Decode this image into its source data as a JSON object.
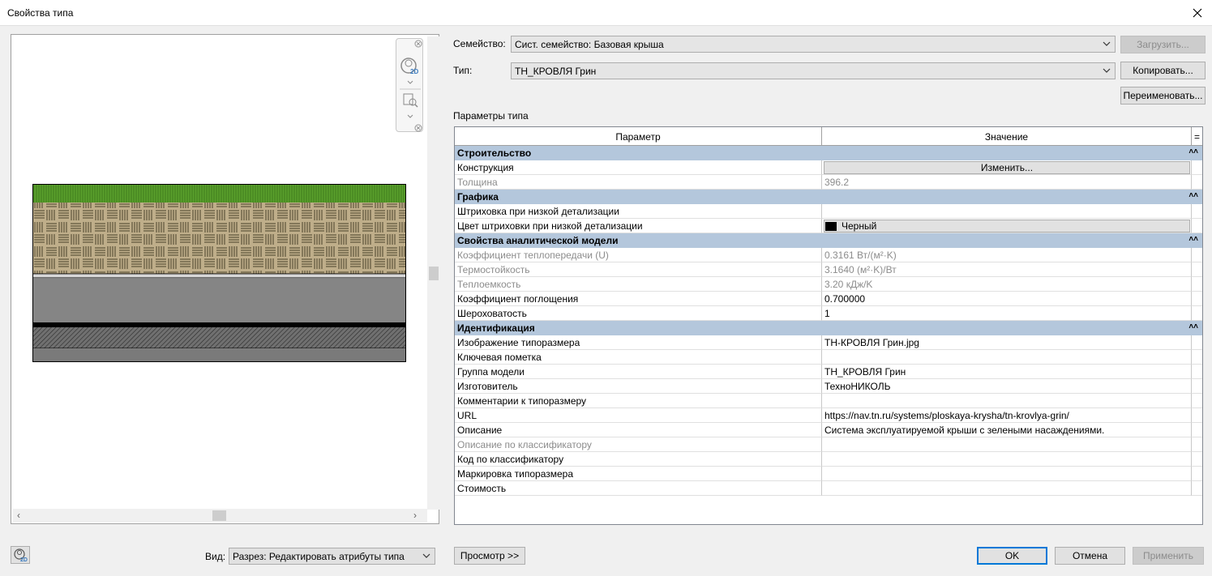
{
  "window": {
    "title": "Свойства типа",
    "close_icon": "close-icon"
  },
  "family": {
    "label": "Семейство:",
    "value": "Сист. семейство: Базовая крыша",
    "load_button": "Загрузить..."
  },
  "type": {
    "label": "Тип:",
    "value": "ТН_КРОВЛЯ Грин",
    "copy_button": "Копировать...",
    "rename_button": "Переименовать..."
  },
  "type_params_label": "Параметры типа",
  "table": {
    "col_param": "Параметр",
    "col_value": "Значение",
    "col_extra": "=",
    "groups": [
      {
        "name": "Строительство",
        "rows": [
          {
            "param": "Конструкция",
            "value": "Изменить...",
            "kind": "button"
          },
          {
            "param": "Толщина",
            "value": "396.2",
            "kind": "gray"
          }
        ]
      },
      {
        "name": "Графика",
        "rows": [
          {
            "param": "Штриховка при низкой детализации",
            "value": ""
          },
          {
            "param": "Цвет штриховки при низкой детализации",
            "value": "Черный",
            "kind": "color"
          }
        ]
      },
      {
        "name": "Свойства аналитической модели",
        "rows": [
          {
            "param": "Коэффициент теплопередачи (U)",
            "value": "0.3161 Вт/(м²·K)",
            "kind": "gray"
          },
          {
            "param": "Термостойкость",
            "value": "3.1640 (м²·K)/Вт",
            "kind": "gray"
          },
          {
            "param": "Теплоемкость",
            "value": "3.20 кДж/K",
            "kind": "gray"
          },
          {
            "param": "Коэффициент поглощения",
            "value": "0.700000"
          },
          {
            "param": "Шероховатость",
            "value": "1"
          }
        ]
      },
      {
        "name": "Идентификация",
        "rows": [
          {
            "param": "Изображение типоразмера",
            "value": "ТН-КРОВЛЯ Грин.jpg"
          },
          {
            "param": "Ключевая пометка",
            "value": ""
          },
          {
            "param": "Группа модели",
            "value": "ТН_КРОВЛЯ Грин"
          },
          {
            "param": "Изготовитель",
            "value": "ТехноНИКОЛЬ"
          },
          {
            "param": "Комментарии к типоразмеру",
            "value": ""
          },
          {
            "param": "URL",
            "value": "https://nav.tn.ru/systems/ploskaya-krysha/tn-krovlya-grin/"
          },
          {
            "param": "Описание",
            "value": "Система эксплуатируемой крыши с зелеными насаждениями."
          },
          {
            "param": "Описание по классификатору",
            "value": "",
            "kind": "gray"
          },
          {
            "param": "Код по классификатору",
            "value": ""
          },
          {
            "param": "Маркировка типоразмера",
            "value": ""
          },
          {
            "param": "Стоимость",
            "value": ""
          }
        ]
      }
    ]
  },
  "bottom": {
    "view_label": "Вид:",
    "view_value": "Разрез: Редактировать атрибуты типа",
    "preview_button": "Просмотр >>",
    "ok": "OK",
    "cancel": "Отмена",
    "apply": "Применить"
  },
  "colors": {
    "group_header": "#b4c7dc",
    "grass": "#5aa02c",
    "tile": "#bfae8a",
    "concrete": "#858585"
  }
}
